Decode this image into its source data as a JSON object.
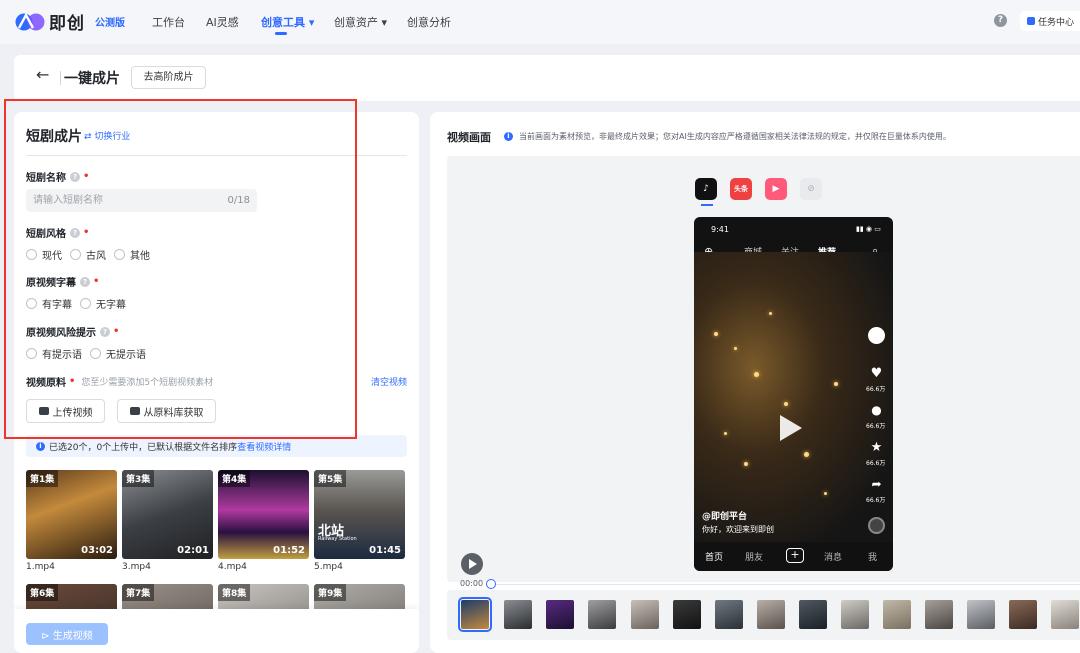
{
  "app": {
    "name": "即创",
    "badge": "公测版"
  },
  "nav": {
    "items": [
      {
        "label": "工作台"
      },
      {
        "label": "AI灵感"
      },
      {
        "label": "创意工具 ▾"
      },
      {
        "label": "创意资产 ▾"
      },
      {
        "label": "创意分析"
      }
    ],
    "help": "?",
    "task_center": "任务中心"
  },
  "header": {
    "back": "←",
    "title": "一键成片",
    "advanced_button": "去高阶成片"
  },
  "left": {
    "title": "短剧成片",
    "switch_industry": "⇄ 切换行业",
    "name_label": "短剧名称",
    "name_placeholder": "请输入短剧名称",
    "name_count": "0/18",
    "style_label": "短剧风格",
    "style_options": [
      "现代",
      "古风",
      "其他"
    ],
    "subtitle_label": "原视频字幕",
    "subtitle_options": [
      "有字幕",
      "无字幕"
    ],
    "risk_label": "原视频风险提示",
    "risk_options": [
      "有提示语",
      "无提示语"
    ],
    "material_label": "视频原料",
    "material_hint": "您至少需要添加5个短剧视频素材",
    "clear": "清空视频",
    "upload_button": "上传视频",
    "library_button": "从原料库获取",
    "info_text": "已选20个，0个上传中，已默认根据文件名排序",
    "info_link": "查看视频详情",
    "clips": [
      {
        "ep": "第1集",
        "dur": "03:02",
        "file": "1.mp4"
      },
      {
        "ep": "第3集",
        "dur": "02:01",
        "file": "3.mp4"
      },
      {
        "ep": "第4集",
        "dur": "01:52",
        "file": "4.mp4"
      },
      {
        "ep": "第5集",
        "dur": "01:45",
        "file": "5.mp4"
      },
      {
        "ep": "第6集",
        "dur": "",
        "file": ""
      },
      {
        "ep": "第7集",
        "dur": "",
        "file": ""
      },
      {
        "ep": "第8集",
        "dur": "",
        "file": ""
      },
      {
        "ep": "第9集",
        "dur": "",
        "file": ""
      }
    ],
    "thumb4_text": "北站",
    "thumb4_sub": "Railway Station",
    "generate_button": "⊳ 生成视频"
  },
  "right": {
    "title": "视频画面",
    "notice": "当前画面为素材预览，非最终成片效果；您对AI生成内容应严格遵循国家相关法律法规的规定，并仅限在巨量体系内使用。",
    "platforms": [
      "抖音",
      "头条",
      "西瓜",
      "其他"
    ],
    "phone": {
      "time": "9:41",
      "tabs": [
        "商城",
        "关注",
        "推荐"
      ],
      "author": "@即创平台",
      "caption": "你好，欢迎来到即创",
      "counts": [
        "66.6万",
        "66.6万",
        "66.6万",
        "66.6万"
      ],
      "bottom_nav": [
        "首页",
        "朋友",
        "+",
        "消息",
        "我"
      ]
    },
    "timecode": "00:00"
  }
}
